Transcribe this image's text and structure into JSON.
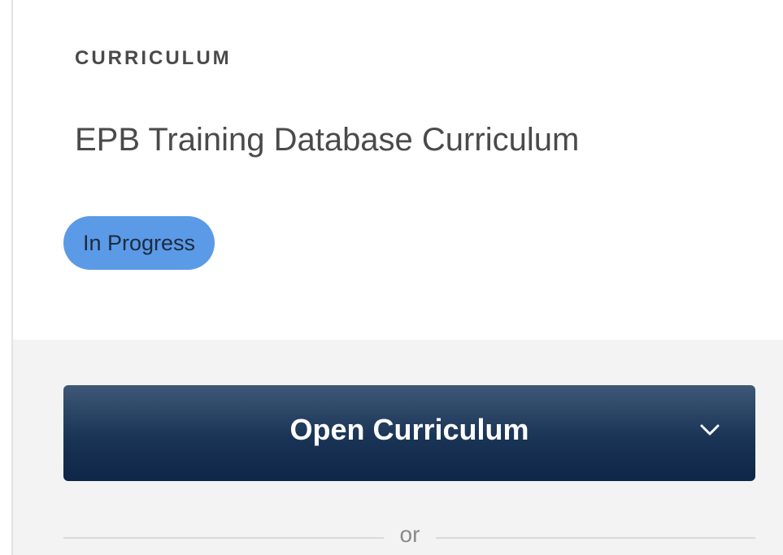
{
  "card": {
    "eyebrow": "CURRICULUM",
    "title": "EPB Training Database Curriculum",
    "status": "In Progress"
  },
  "actions": {
    "primary_button_label": "Open Curriculum",
    "primary_button_icon": "chevron-down-icon",
    "divider_text": "or"
  },
  "colors": {
    "status_badge": "#5b9ae6",
    "button_top": "#3f5877",
    "button_bottom": "#0e2647",
    "actions_background": "#f3f3f3"
  }
}
